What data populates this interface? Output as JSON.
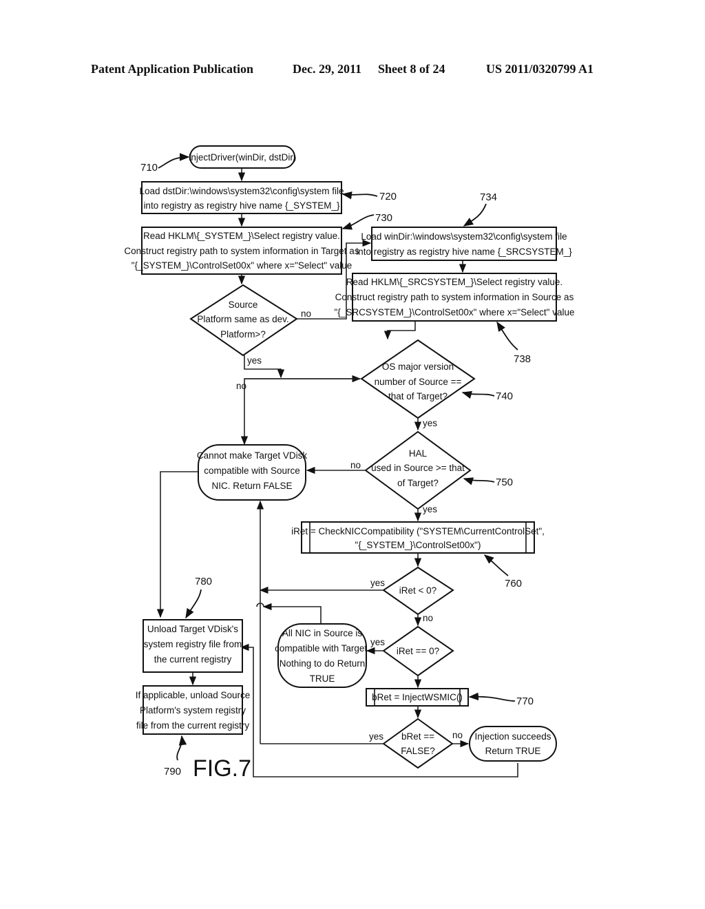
{
  "header": {
    "publication": "Patent Application Publication",
    "date": "Dec. 29, 2011",
    "sheet": "Sheet 8 of 24",
    "number": "US 2011/0320799 A1"
  },
  "figure_label": "FIG.7",
  "nodes": {
    "start": {
      "ref": "710",
      "lines": [
        "InjectDriver(winDir, dstDir)"
      ]
    },
    "load_dst": {
      "ref": "720",
      "lines": [
        "Load dstDir:\\windows\\system32\\config\\system file",
        "into registry as registry hive name {_SYSTEM_}"
      ]
    },
    "read_target": {
      "ref": "730",
      "lines": [
        "Read HKLM\\{_SYSTEM_}\\Select registry value.",
        "Construct registry path to system information in Target as",
        "\"{_SYSTEM_}\\ControlSet00x\" where x=\"Select\" value"
      ]
    },
    "load_src": {
      "ref": "734",
      "lines": [
        "Load winDir:\\windows\\system32\\config\\system file",
        "into registry as registry hive name {_SRCSYSTEM_}"
      ]
    },
    "read_source": {
      "ref": "738",
      "lines": [
        "Read HKLM\\{_SRCSYSTEM_}\\Select registry value.",
        "Construct registry path to system information in Source as",
        "\"{_SRCSYSTEM_}\\ControlSet00x\" where x=\"Select\" value"
      ]
    },
    "platform_check": {
      "lines": [
        "Source",
        "Platform same as dev.",
        "Platform>?"
      ]
    },
    "os_check": {
      "ref": "740",
      "lines": [
        "OS major version",
        "number of Source ==",
        "that of Target?"
      ]
    },
    "hal_check": {
      "ref": "750",
      "lines": [
        "HAL",
        "used in Source >= that",
        "of Target?"
      ]
    },
    "cannot": {
      "lines": [
        "Cannot make Target VDisk",
        "compatible with Source",
        "NIC. Return FALSE"
      ]
    },
    "check_nic": {
      "ref": "760",
      "lines": [
        "iRet = CheckNICCompatibility (\"SYSTEM\\CurrentControlSet\",",
        "\"{_SYSTEM_}\\ControlSet00x\")"
      ]
    },
    "iret_lt": {
      "lines": [
        "iRet < 0?"
      ]
    },
    "iret_eq": {
      "lines": [
        "iRet == 0?"
      ]
    },
    "all_nic": {
      "lines": [
        "All NIC in Source is",
        "compatible with Target.",
        "Nothing to do Return",
        "TRUE"
      ]
    },
    "inject": {
      "ref": "770",
      "lines": [
        "bRet = InjectWSMIC()"
      ]
    },
    "bret_check": {
      "lines": [
        "bRet ==",
        "FALSE?"
      ]
    },
    "success": {
      "lines": [
        "Injection succeeds",
        "Return TRUE"
      ]
    },
    "unload_target": {
      "ref": "780",
      "lines": [
        "Unload Target VDisk's",
        "system registry file from",
        "the current registry"
      ]
    },
    "unload_source": {
      "ref": "790",
      "lines": [
        "If applicable, unload Source",
        "Platform's system registry",
        "file from the current registry"
      ]
    }
  },
  "edge_labels": {
    "platform_no": "no",
    "platform_yes": "yes",
    "os_no": "no",
    "os_yes": "yes",
    "hal_no": "no",
    "hal_yes": "yes",
    "iret_lt_yes": "yes",
    "iret_lt_no": "no",
    "iret_eq_yes": "yes",
    "bret_yes": "yes",
    "bret_no": "no"
  }
}
